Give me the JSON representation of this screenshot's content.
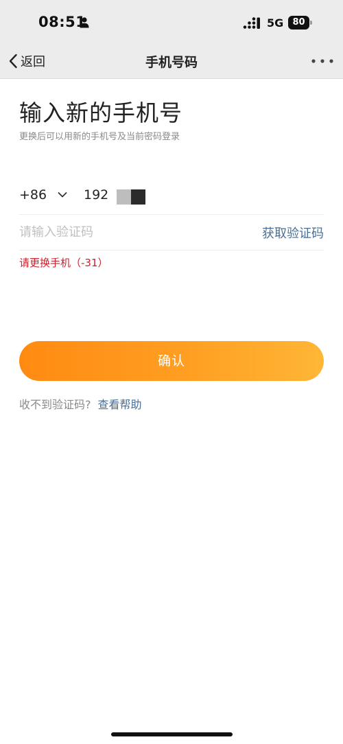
{
  "status_bar": {
    "time": "08:51",
    "network": "5G",
    "battery": "80",
    "icons": [
      "person-icon",
      "signal-icon",
      "battery-icon"
    ]
  },
  "nav": {
    "back_label": "返回",
    "title": "手机号码",
    "icons": [
      "chevron-left-icon",
      "more-icon"
    ]
  },
  "form": {
    "heading": "输入新的手机号",
    "subtitle": "更换后可以用新的手机号及当前密码登录",
    "country_code": "+86",
    "phone_value": "192",
    "code_placeholder": "请输入验证码",
    "get_code_label": "获取验证码",
    "error_message": "请更换手机（-31）",
    "confirm_label": "确认",
    "help_prompt": "收不到验证码?",
    "help_link": "查看帮助"
  },
  "colors": {
    "accent_orange": "#ff8a12",
    "accent_orange_light": "#ffb636",
    "link_blue": "#4a6f95",
    "error_red": "#cc1f2d",
    "bar_gray": "#ececec"
  }
}
